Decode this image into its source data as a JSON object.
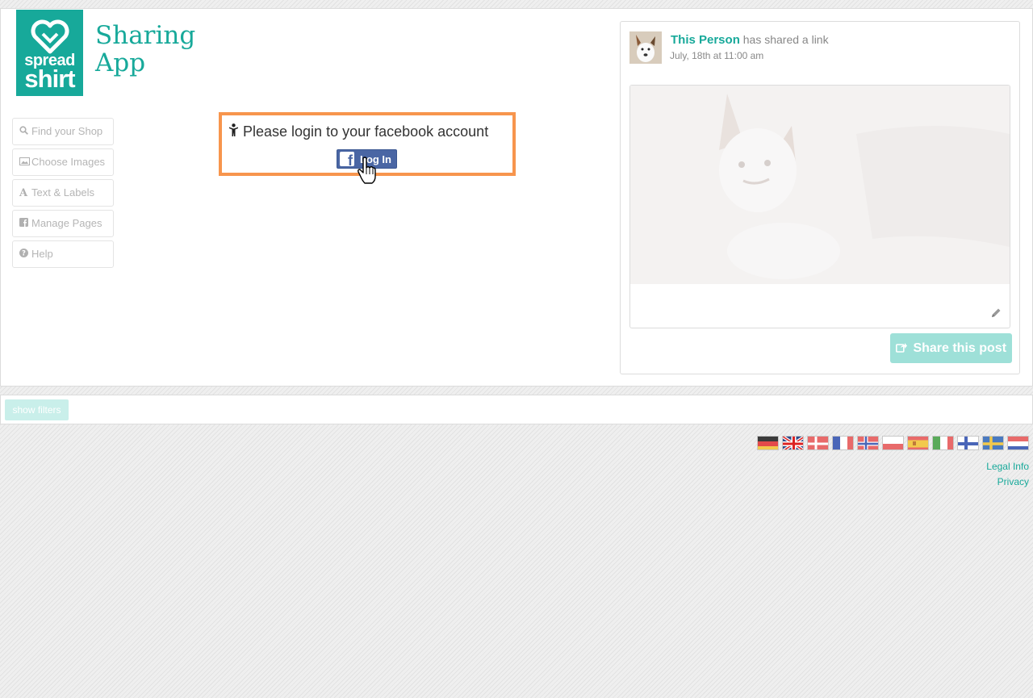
{
  "brand": {
    "logo_line1": "spread",
    "logo_line2": "shirt",
    "title_line1": "Sharing",
    "title_line2": "App"
  },
  "nav": {
    "items": [
      {
        "label": "Find your Shop",
        "icon": "search-icon"
      },
      {
        "label": "Choose Images",
        "icon": "image-icon"
      },
      {
        "label": "Text & Labels",
        "icon": "font-icon"
      },
      {
        "label": "Manage Pages",
        "icon": "facebook-square-icon"
      },
      {
        "label": "Help",
        "icon": "question-circle-icon"
      }
    ]
  },
  "login": {
    "message": "Please login to your facebook account",
    "button_label": "Log In"
  },
  "preview": {
    "person_name": "This Person",
    "action_text": "has shared a link",
    "date": "July, 18th at 11:00 am",
    "share_label": "Share this post"
  },
  "filters": {
    "button_label": "show filters"
  },
  "footer": {
    "languages": [
      "de",
      "en",
      "da",
      "fr",
      "no",
      "pl",
      "es",
      "it",
      "fi",
      "sv",
      "nl"
    ],
    "legal_label": "Legal Info",
    "privacy_label": "Privacy"
  },
  "colors": {
    "accent": "#17a99a",
    "highlight": "#f7954d",
    "facebook": "#4a66a4"
  }
}
